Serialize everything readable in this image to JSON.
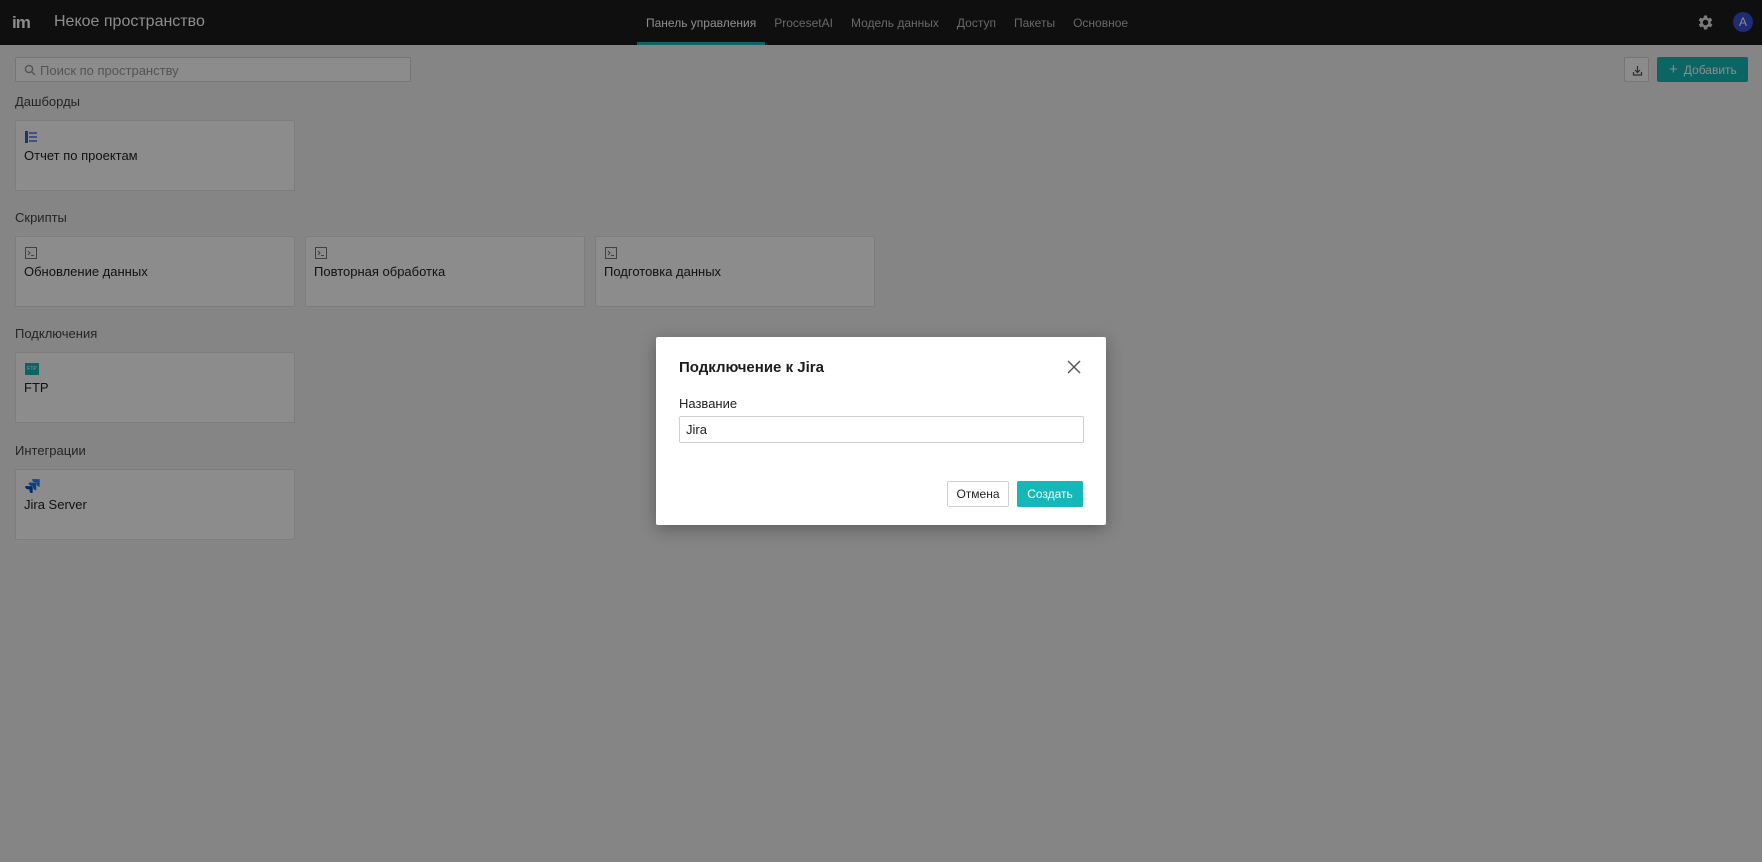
{
  "app": {
    "logo_text": "im",
    "space_title": "Некое пространство"
  },
  "nav": {
    "tabs": [
      {
        "label": "Панель управления",
        "active": true
      },
      {
        "label": "ProcesetAI"
      },
      {
        "label": "Модель данных"
      },
      {
        "label": "Доступ"
      },
      {
        "label": "Пакеты"
      },
      {
        "label": "Основное"
      }
    ],
    "settings_icon": "gear-icon",
    "avatar_letter": "A"
  },
  "toolbar": {
    "search_placeholder": "Поиск по пространству",
    "download_icon": "download-icon",
    "add_label": "Добавить"
  },
  "sections": {
    "dashboards": {
      "title": "Дашборды",
      "items": [
        {
          "label": "Отчет по проектам",
          "icon": "dashboard-icon"
        }
      ]
    },
    "scripts": {
      "title": "Скрипты",
      "items": [
        {
          "label": "Обновление данных",
          "icon": "script-icon"
        },
        {
          "label": "Повторная обработка",
          "icon": "script-icon"
        },
        {
          "label": "Подготовка данных",
          "icon": "script-icon"
        }
      ]
    },
    "connections": {
      "title": "Подключения",
      "items": [
        {
          "label": "FTP",
          "icon": "ftp-icon",
          "icon_text": "FTP"
        }
      ]
    },
    "integrations": {
      "title": "Интеграции",
      "items": [
        {
          "label": "Jira Server",
          "icon": "jira-icon"
        }
      ]
    }
  },
  "dialog": {
    "title": "Подключение к Jira",
    "field_label": "Название",
    "field_value": "Jira",
    "cancel_label": "Отмена",
    "create_label": "Создать"
  },
  "colors": {
    "accent": "#14b8b8",
    "topbar": "#1c1c1c",
    "avatar": "#3a4fd0"
  }
}
